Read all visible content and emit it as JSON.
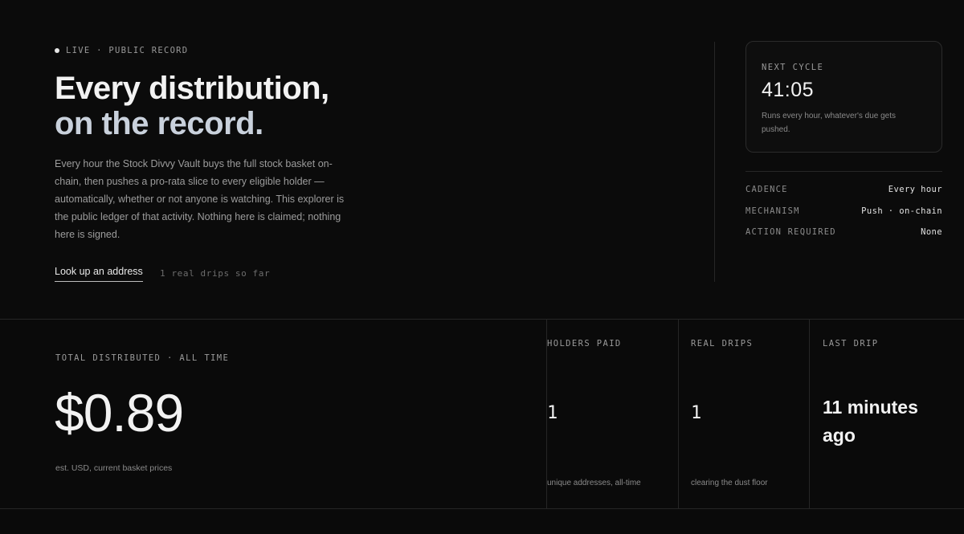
{
  "hero": {
    "live_badge": "LIVE · PUBLIC RECORD",
    "headline_line1": "Every distribution,",
    "headline_line2": "on the record.",
    "description": "Every hour the Stock Divvy Vault buys the full stock basket on-chain, then pushes a pro-rata slice to every eligible holder — automatically, whether or not anyone is watching. This explorer is the public ledger of that activity. Nothing here is claimed; nothing here is signed.",
    "lookup_link": "Look up an address",
    "drips_note": "1 real drips so far"
  },
  "cycle": {
    "label": "NEXT CYCLE",
    "time": "41:05",
    "note": "Runs every hour, whatever's due gets pushed."
  },
  "details": [
    {
      "key": "CADENCE",
      "value": "Every hour"
    },
    {
      "key": "MECHANISM",
      "value": "Push · on-chain"
    },
    {
      "key": "ACTION REQUIRED",
      "value": "None"
    }
  ],
  "total": {
    "label": "TOTAL DISTRIBUTED · ALL TIME",
    "value": "$0.89",
    "note": "est. USD, current basket prices"
  },
  "stats": [
    {
      "label": "HOLDERS PAID",
      "value": "1",
      "note": "unique addresses, all-time"
    },
    {
      "label": "REAL DRIPS",
      "value": "1",
      "note": "clearing the dust floor"
    },
    {
      "label": "LAST DRIP",
      "value": "11 minutes ago",
      "note": ""
    }
  ]
}
